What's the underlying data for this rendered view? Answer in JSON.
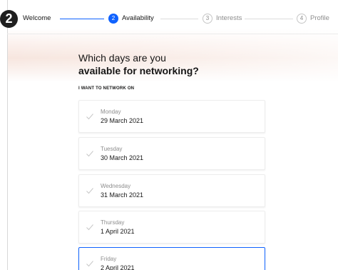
{
  "step_badge": "2",
  "progress": {
    "steps": [
      {
        "label": "Welcome",
        "status": "done"
      },
      {
        "label": "Availability",
        "number": "2",
        "status": "active"
      },
      {
        "label": "Interests",
        "number": "3",
        "status": "pending"
      },
      {
        "label": "Profile",
        "number": "4",
        "status": "pending"
      }
    ]
  },
  "heading": {
    "line1": "Which days are you",
    "line2": "available for networking?"
  },
  "section_label": "I WANT TO NETWORK ON",
  "days": [
    {
      "name": "Monday",
      "date": "29 March 2021"
    },
    {
      "name": "Tuesday",
      "date": "30 March 2021"
    },
    {
      "name": "Wednesday",
      "date": "31 March 2021"
    },
    {
      "name": "Thursday",
      "date": "1 April 2021"
    },
    {
      "name": "Friday",
      "date": "2 April 2021"
    }
  ],
  "colors": {
    "accent": "#0f62fe",
    "badge": "#1f1f1f",
    "muted_text": "#8d8d8d"
  }
}
